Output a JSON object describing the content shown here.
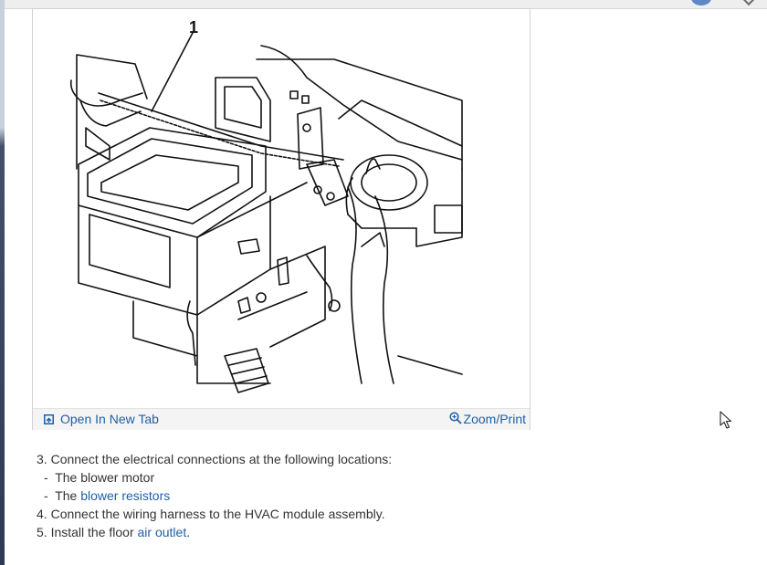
{
  "figure": {
    "callout_number": "1",
    "footer": {
      "open_tab_label": "Open In New Tab",
      "zoom_label": "Zoom/Print"
    }
  },
  "steps": [
    {
      "number": "3.",
      "text": "Connect the electrical connections at the following locations:",
      "sub_items": [
        {
          "prefix": "-  The ",
          "label": "blower motor",
          "is_link": false
        },
        {
          "prefix": "-  The ",
          "label": "blower resistors",
          "is_link": true
        }
      ]
    },
    {
      "number": "4.",
      "text": "Connect the wiring harness to the HVAC module assembly."
    },
    {
      "number": "5.",
      "text_before": "Install the floor ",
      "link": "air outlet",
      "text_after": "."
    }
  ],
  "colors": {
    "link": "#1f5fa6",
    "body_text": "#333333",
    "footer_bg": "#f4f4f4"
  }
}
